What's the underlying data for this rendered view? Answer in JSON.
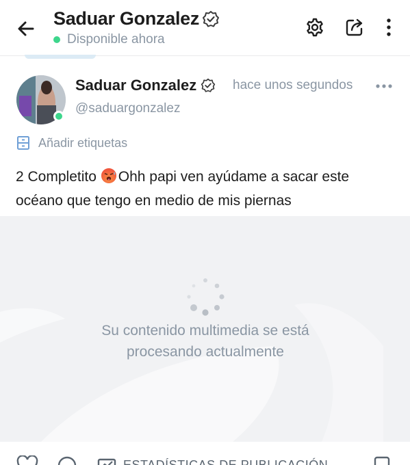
{
  "header": {
    "title": "Saduar Gonzalez",
    "status": "Disponible ahora",
    "icons": [
      "back-arrow-icon",
      "gear-icon",
      "share-icon",
      "more-vertical-icon"
    ]
  },
  "post": {
    "author_name": "Saduar Gonzalez",
    "handle": "@saduargonzalez",
    "time": "hace unos segundos",
    "tags_label": "Añadir etiquetas",
    "text_part1": "2 Completito ",
    "text_part2": "Ohh papi ven ayúdame a sacar este océano que tengo en medio de mis piernas"
  },
  "media": {
    "processing_message": "Su contenido multimedia se está procesando actualmente"
  },
  "actions": {
    "stats_label": "ESTADÍSTICAS DE PUBLICACIÓN"
  },
  "colors": {
    "online": "#3dd68c",
    "muted_text": "#8a96a3",
    "accent": "#00aff0"
  }
}
